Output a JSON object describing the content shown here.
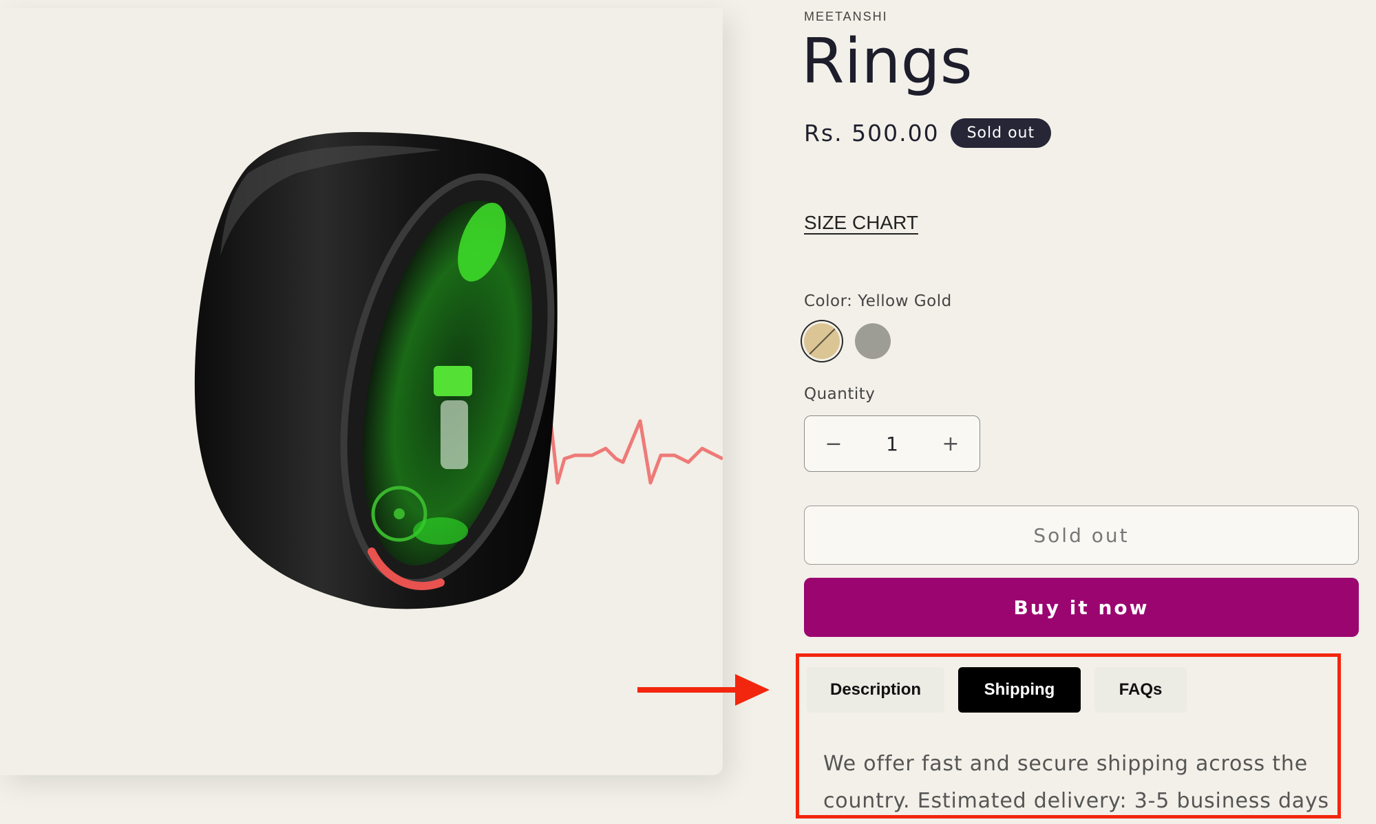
{
  "product": {
    "vendor": "MEETANSHI",
    "title": "Rings",
    "price": "Rs. 500.00",
    "badge": "Sold out",
    "size_chart_label": "SIZE CHART",
    "color_label": "Color: Yellow Gold",
    "color_options": [
      {
        "name": "Yellow Gold",
        "color": "#dcc595",
        "selected": true
      },
      {
        "name": "Silver",
        "color": "#9d9c95",
        "selected": false
      }
    ],
    "quantity_label": "Quantity",
    "quantity_value": "1",
    "minus_symbol": "−",
    "plus_symbol": "+",
    "sold_out_button": "Sold out",
    "buy_button": "Buy it now"
  },
  "tabs": [
    {
      "label": "Description",
      "active": false
    },
    {
      "label": "Shipping",
      "active": true
    },
    {
      "label": "FAQs",
      "active": false
    }
  ],
  "tab_content": "We offer fast and secure shipping across the country. Estimated delivery: 3-5 business days",
  "colors": {
    "accent": "#9b0570",
    "highlight": "#f2260e",
    "badge_bg": "#262637",
    "ring_green": "#37e026",
    "heartbeat": "#ee7a78"
  },
  "icons": [
    "ring-product-image",
    "heartbeat-line",
    "red-arrow-icon"
  ]
}
